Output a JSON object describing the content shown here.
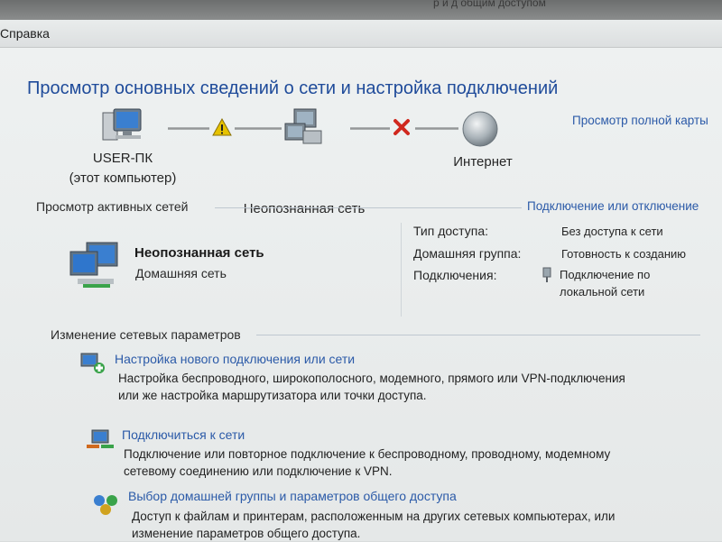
{
  "window": {
    "title_partial": "р и д общим доступом"
  },
  "menu": {
    "help_label": "Справка"
  },
  "page_title": "Просмотр основных сведений о сети и настройка подключений",
  "network_map": {
    "view_full_map_link": "Просмотр полной карты",
    "nodes": [
      {
        "label": "USER-ПК",
        "sublabel": "(этот компьютер)",
        "icon": "computer-icon"
      },
      {
        "label": "Неопознанная сеть",
        "icon": "network-icon"
      },
      {
        "label": "Интернет",
        "icon": "globe-icon"
      }
    ],
    "links": [
      {
        "status_icon": "warning-icon",
        "color": "#e6c200"
      },
      {
        "status_icon": "red-x-icon",
        "color": "#d0281e"
      }
    ]
  },
  "active_networks": {
    "section_label": "Просмотр активных сетей",
    "connect_disconnect_link": "Подключение или отключение",
    "network": {
      "name": "Неопознанная сеть",
      "type": "Домашняя сеть",
      "icon": "home-network-icon"
    },
    "properties": [
      {
        "key": "Тип доступа:",
        "value": "Без доступа к сети",
        "is_link": false
      },
      {
        "key": "Домашняя группа:",
        "value": "Готовность к созданию",
        "is_link": true
      },
      {
        "key": "Подключения:",
        "value_line1": "Подключение по",
        "value_line2": "локальной сети",
        "is_link": true,
        "icon": "ethernet-icon"
      }
    ]
  },
  "change_settings": {
    "section_label": "Изменение сетевых параметров",
    "tasks": [
      {
        "title": "Настройка нового подключения или сети",
        "desc_line1": "Настройка беспроводного, широкополосного, модемного, прямого или VPN-подключения",
        "desc_line2": "или же настройка маршрутизатора или точки доступа.",
        "icon": "new-connection-icon"
      },
      {
        "title": "Подключиться к сети",
        "desc_line1": "Подключение или повторное подключение к беспроводному, проводному, модемному",
        "desc_line2": "сетевому соединению или подключение к VPN.",
        "icon": "connect-network-icon"
      },
      {
        "title": "Выбор домашней группы и параметров общего доступа",
        "desc_line1": "Доступ к файлам и принтерам, расположенным на других сетевых компьютерах, или",
        "desc_line2": "изменение параметров общего доступа.",
        "icon": "homegroup-icon"
      }
    ]
  },
  "colors": {
    "link": "#2b5aa8",
    "title": "#1f4b9a",
    "background": "#e9ecec"
  }
}
